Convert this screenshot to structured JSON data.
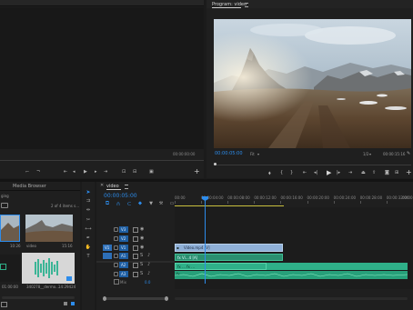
{
  "source": {
    "timecode": "00:00:00:00"
  },
  "program": {
    "title": "Program: video",
    "menu_icon": "hamburger-menu-icon",
    "timecode": "00:00:05:00",
    "zoom_option": "Fit",
    "quality_option": "1/2",
    "duration": "00:00:15:16"
  },
  "media_browser": {
    "tab_label": "Media Browser",
    "panel_label": "ging",
    "item_count": "2 of 4 items s...",
    "items": [
      {
        "name": "",
        "duration": "10:26"
      },
      {
        "name": "video",
        "duration": "15:16"
      },
      {
        "name": "01:00:00",
        "duration": ""
      },
      {
        "name": "340278__dermo...",
        "duration": "14:29424"
      }
    ]
  },
  "timeline": {
    "sequence_title": "video",
    "menu_icon": "hamburger-menu-icon",
    "close_icon": "close-icon",
    "timecode": "00:00:05:00",
    "ruler": [
      "00:00",
      "00:00:04:00",
      "00:00:08:00",
      "00:00:12:00",
      "00:00:16:00",
      "00:00:20:00",
      "00:00:24:00",
      "00:00:28:00",
      "00:00:32:00",
      "00:00"
    ],
    "video_tracks": [
      "V3",
      "V2",
      "V1"
    ],
    "audio_tracks": [
      "A1",
      "A2",
      "A3"
    ],
    "mix_label": "Mix",
    "mix_value": "0.0",
    "video_clip_label": "Video.mp4 [V]",
    "audio_clip_a1": "fx  Vi...4  [A]",
    "audio_clip_a2": "fx  ...    fx  ...",
    "audio_clip_a3": "fx",
    "source_patch_label": "V1"
  },
  "colors": {
    "accent": "#2d8ceb",
    "video_clip": "#8fb0d8",
    "audio_clip": "#2fb089",
    "background": "#1b1b1b"
  }
}
